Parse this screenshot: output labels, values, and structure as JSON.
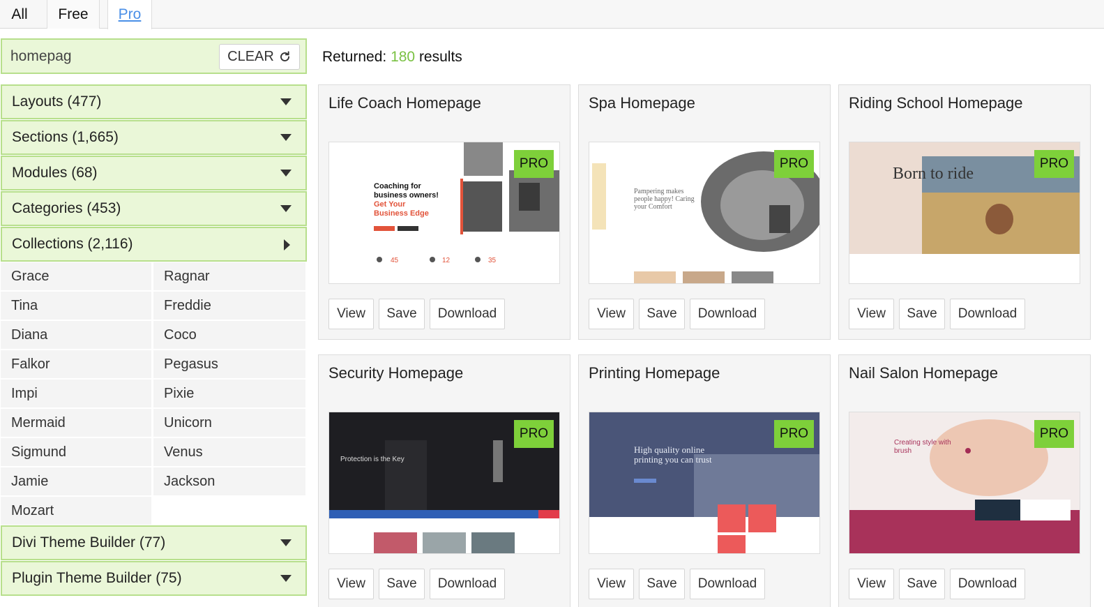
{
  "tabs": {
    "all": "All",
    "free": "Free",
    "pro": "Pro"
  },
  "search": {
    "value": "homepag",
    "clear_label": "CLEAR"
  },
  "results": {
    "prefix": "Returned: ",
    "count": "180",
    "suffix": " results"
  },
  "filters": {
    "layouts": "Layouts (477)",
    "sections": "Sections (1,665)",
    "modules": "Modules (68)",
    "categories": "Categories (453)",
    "collections": "Collections (2,116)",
    "divi_theme_builder": "Divi Theme Builder (77)",
    "plugin_theme_builder": "Plugin Theme Builder (75)"
  },
  "collections": [
    "Grace",
    "Ragnar",
    "Tina",
    "Freddie",
    "Diana",
    "Coco",
    "Falkor",
    "Pegasus",
    "Impi",
    "Pixie",
    "Mermaid",
    "Unicorn",
    "Sigmund",
    "Venus",
    "Jamie",
    "Jackson",
    "Mozart"
  ],
  "card_buttons": {
    "view": "View",
    "save": "Save",
    "download": "Download"
  },
  "badge": "PRO",
  "cards": [
    {
      "title": "Life Coach Homepage",
      "thumb": {
        "l1": "Coaching for",
        "l2": "business owners!",
        "l3": "Get Your",
        "l4": "Business Edge",
        "s1": "45",
        "s2": "12",
        "s3": "35"
      }
    },
    {
      "title": "Spa Homepage",
      "thumb": {
        "l1": "Pampering makes",
        "l2": "people happy! Caring",
        "l3": "your Comfort"
      }
    },
    {
      "title": "Riding School Homepage",
      "thumb": {
        "l1": "Born to ride"
      }
    },
    {
      "title": "Security Homepage",
      "thumb": {
        "l1": "Protection is the Key"
      }
    },
    {
      "title": "Printing Homepage",
      "thumb": {
        "l1": "High quality online",
        "l2": "printing you can trust"
      }
    },
    {
      "title": "Nail Salon Homepage",
      "thumb": {
        "l1": "Creating style with",
        "l2": "brush"
      }
    }
  ],
  "colors": {
    "accent_green": "#7ed03a",
    "filter_bg": "#eaf7d8",
    "count_green": "#7ac143",
    "link_blue": "#4a8fe7"
  }
}
